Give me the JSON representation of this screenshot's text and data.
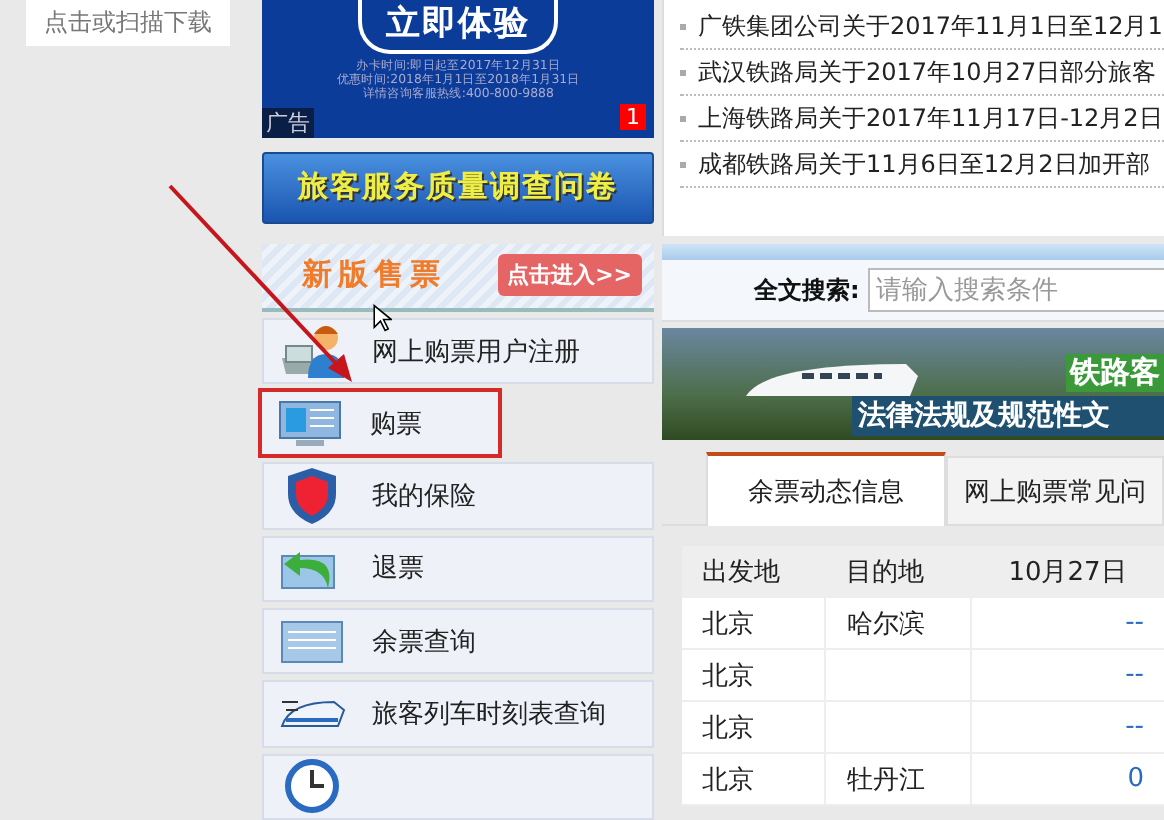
{
  "download_hint": "点击或扫描下载",
  "ad_banner": {
    "button": "立即体验",
    "lines": [
      "办卡时间:即日起至2017年12月31日",
      "优惠时间:2018年1月1日至2018年1月31日",
      "详情咨询客服热线:400-800-9888"
    ],
    "label": "广告",
    "badge": "1"
  },
  "survey_button": "旅客服务质量调查问卷",
  "new_ticketing": {
    "title": "新版售票",
    "button": "点击进入>>"
  },
  "menu": [
    {
      "label": "网上购票用户注册",
      "kind": "register",
      "highlighted": false
    },
    {
      "label": "购票",
      "kind": "computer",
      "highlighted": true
    },
    {
      "label": "我的保险",
      "kind": "shield",
      "highlighted": false
    },
    {
      "label": "退票",
      "kind": "refund",
      "highlighted": false
    },
    {
      "label": "余票查询",
      "kind": "ticket",
      "highlighted": false
    },
    {
      "label": "旅客列车时刻表查询",
      "kind": "train",
      "highlighted": false
    },
    {
      "kind": "clock",
      "highlighted": false
    }
  ],
  "news": [
    "广铁集团公司关于2017年11月1日至12月1",
    "武汉铁路局关于2017年10月27日部分旅客",
    "上海铁路局关于2017年11月17日-12月2日",
    "成都铁路局关于11月6日至12月2日加开部"
  ],
  "search": {
    "label": "全文搜索:",
    "placeholder": "请输入搜索条件"
  },
  "banner": {
    "title": "铁路客",
    "subtitle": "法律法规及规范性文"
  },
  "tabs": [
    {
      "label": "余票动态信息",
      "selected": true
    },
    {
      "label": "网上购票常见问",
      "selected": false
    }
  ],
  "table": {
    "columns": [
      "出发地",
      "目的地",
      "10月27日"
    ],
    "rows": [
      {
        "from": "北京",
        "to": "哈尔滨",
        "count": "--"
      },
      {
        "from": "北京",
        "count": "--"
      },
      {
        "from": "北京",
        "count": "--"
      },
      {
        "from": "北京",
        "to": "牡丹江",
        "count": "0"
      }
    ]
  }
}
